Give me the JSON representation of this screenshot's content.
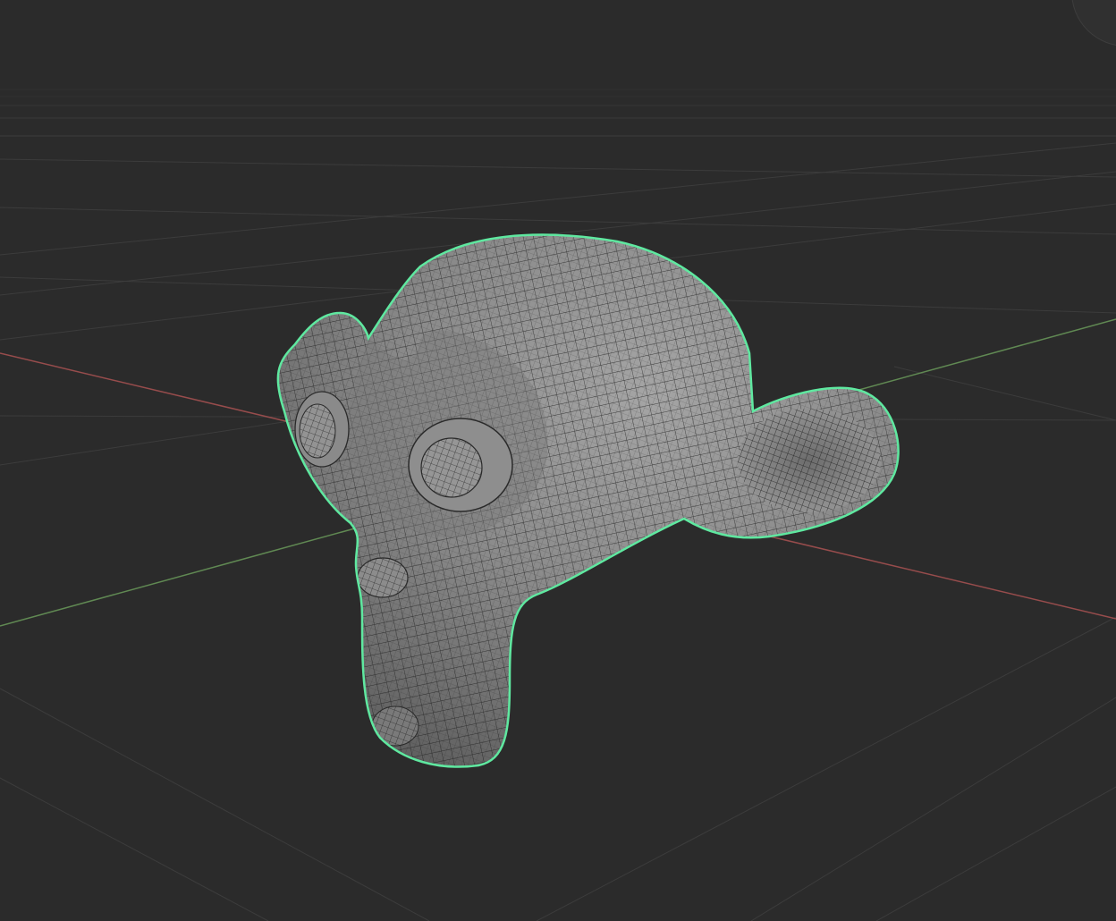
{
  "viewport": {
    "background": "#2b2b2b",
    "object": "Suzanne",
    "shading": "solid-wireframe",
    "selection_outline_color": "#5fe8a0",
    "mesh_color": "#8a8a8a",
    "wire_color": "#1c1c1c",
    "axes": {
      "x_color": "#b25555",
      "y_color": "#6a9a5a"
    },
    "grid_color": "#3c3c3c"
  },
  "gizmo": {
    "icon": "navigation-gizmo-icon"
  }
}
